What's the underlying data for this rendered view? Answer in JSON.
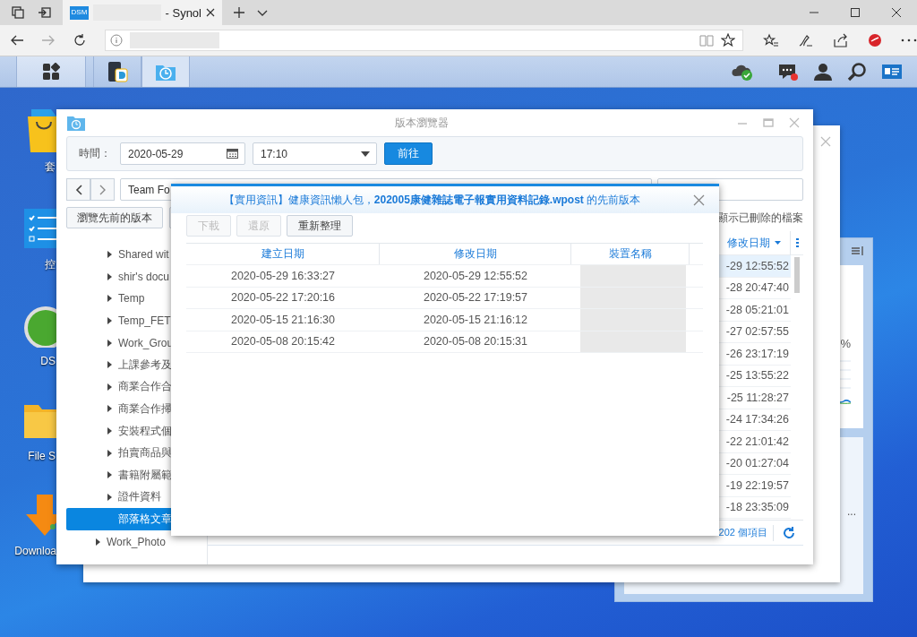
{
  "browser": {
    "favicon": "DSM",
    "tab_title": "- Synol"
  },
  "taskbar": {
    "apps": [
      {
        "kind": "files",
        "selected": false
      },
      {
        "kind": "versions",
        "selected": true
      }
    ],
    "notifications_unread": true
  },
  "desktop_icons": [
    {
      "kind": "package",
      "label": "套"
    },
    {
      "kind": "control",
      "label": "控"
    },
    {
      "kind": "help",
      "label": "DS"
    },
    {
      "kind": "folder",
      "label": "File S"
    },
    {
      "kind": "download",
      "label": "Downloa"
    }
  ],
  "widget": {
    "percent": "%",
    "more": "..."
  },
  "version_browser": {
    "title": "版本瀏覽器",
    "time_label": "時間：",
    "date": "2020-05-29",
    "time": "17:10",
    "go_button": "前往",
    "path": "Team Fo",
    "browse_button": "瀏覽先前的版本",
    "show_deleted": {
      "label": "顯示已刪除的檔案"
    },
    "tree": [
      {
        "children": [
          {
            "label": "Shared wit",
            "expandable": true,
            "selected": false
          },
          {
            "label": "shir's docu",
            "expandable": true,
            "selected": false
          },
          {
            "label": "Temp",
            "expandable": true,
            "selected": false
          },
          {
            "label": "Temp_FET",
            "expandable": true,
            "selected": false
          },
          {
            "label": "Work_Grou",
            "expandable": true,
            "selected": false
          },
          {
            "label": "上課參考及",
            "expandable": true,
            "selected": false
          },
          {
            "label": "商業合作合",
            "expandable": true,
            "selected": false
          },
          {
            "label": "商業合作掃",
            "expandable": true,
            "selected": false
          },
          {
            "label": "安裝程式個",
            "expandable": true,
            "selected": false
          },
          {
            "label": "拍賣商品與",
            "expandable": true,
            "selected": false
          },
          {
            "label": "書籍附屬範",
            "expandable": true,
            "selected": false
          },
          {
            "label": "證件資料",
            "expandable": true,
            "selected": false
          },
          {
            "label": "部落格文章",
            "expandable": false,
            "selected": true
          }
        ]
      },
      {
        "label": "Work_Photo",
        "expandable": true,
        "selected": false
      }
    ],
    "modified_header": "修改日期",
    "rows": [
      {
        "modified": "-29 12:55:52",
        "selected": true
      },
      {
        "modified": "-28 20:47:40",
        "selected": false
      },
      {
        "modified": "-28 05:21:01",
        "selected": false
      },
      {
        "modified": "-27 02:57:55",
        "selected": false
      },
      {
        "modified": "-26 23:17:19",
        "selected": false
      },
      {
        "modified": "-25 13:55:22",
        "selected": false
      },
      {
        "modified": "-25 11:28:27",
        "selected": false
      },
      {
        "modified": "-24 17:34:26",
        "selected": false
      },
      {
        "modified": "-22 21:01:42",
        "selected": false
      },
      {
        "modified": "-20 01:27:04",
        "selected": false
      },
      {
        "modified": "-19 22:19:57",
        "selected": false
      },
      {
        "modified": "-18 23:35:09",
        "selected": false
      }
    ],
    "item_count": "202 個項目"
  },
  "dialog": {
    "title": "【實用資訊】健康資訊懶人包，**202005康健雜誌電子報實用資料記錄.wpost** 的先前版本",
    "buttons": [
      {
        "label": "下載",
        "disabled": true
      },
      {
        "label": "還原",
        "disabled": true
      },
      {
        "label": "重新整理",
        "disabled": false
      }
    ],
    "columns": [
      "建立日期",
      "修改日期",
      "裝置名稱"
    ],
    "rows": [
      {
        "created": "2020-05-29 16:33:27",
        "modified": "2020-05-29 12:55:52"
      },
      {
        "created": "2020-05-22 17:20:16",
        "modified": "2020-05-22 17:19:57"
      },
      {
        "created": "2020-05-15 21:16:30",
        "modified": "2020-05-15 21:16:12"
      },
      {
        "created": "2020-05-08 20:15:42",
        "modified": "2020-05-08 20:15:31"
      }
    ]
  }
}
